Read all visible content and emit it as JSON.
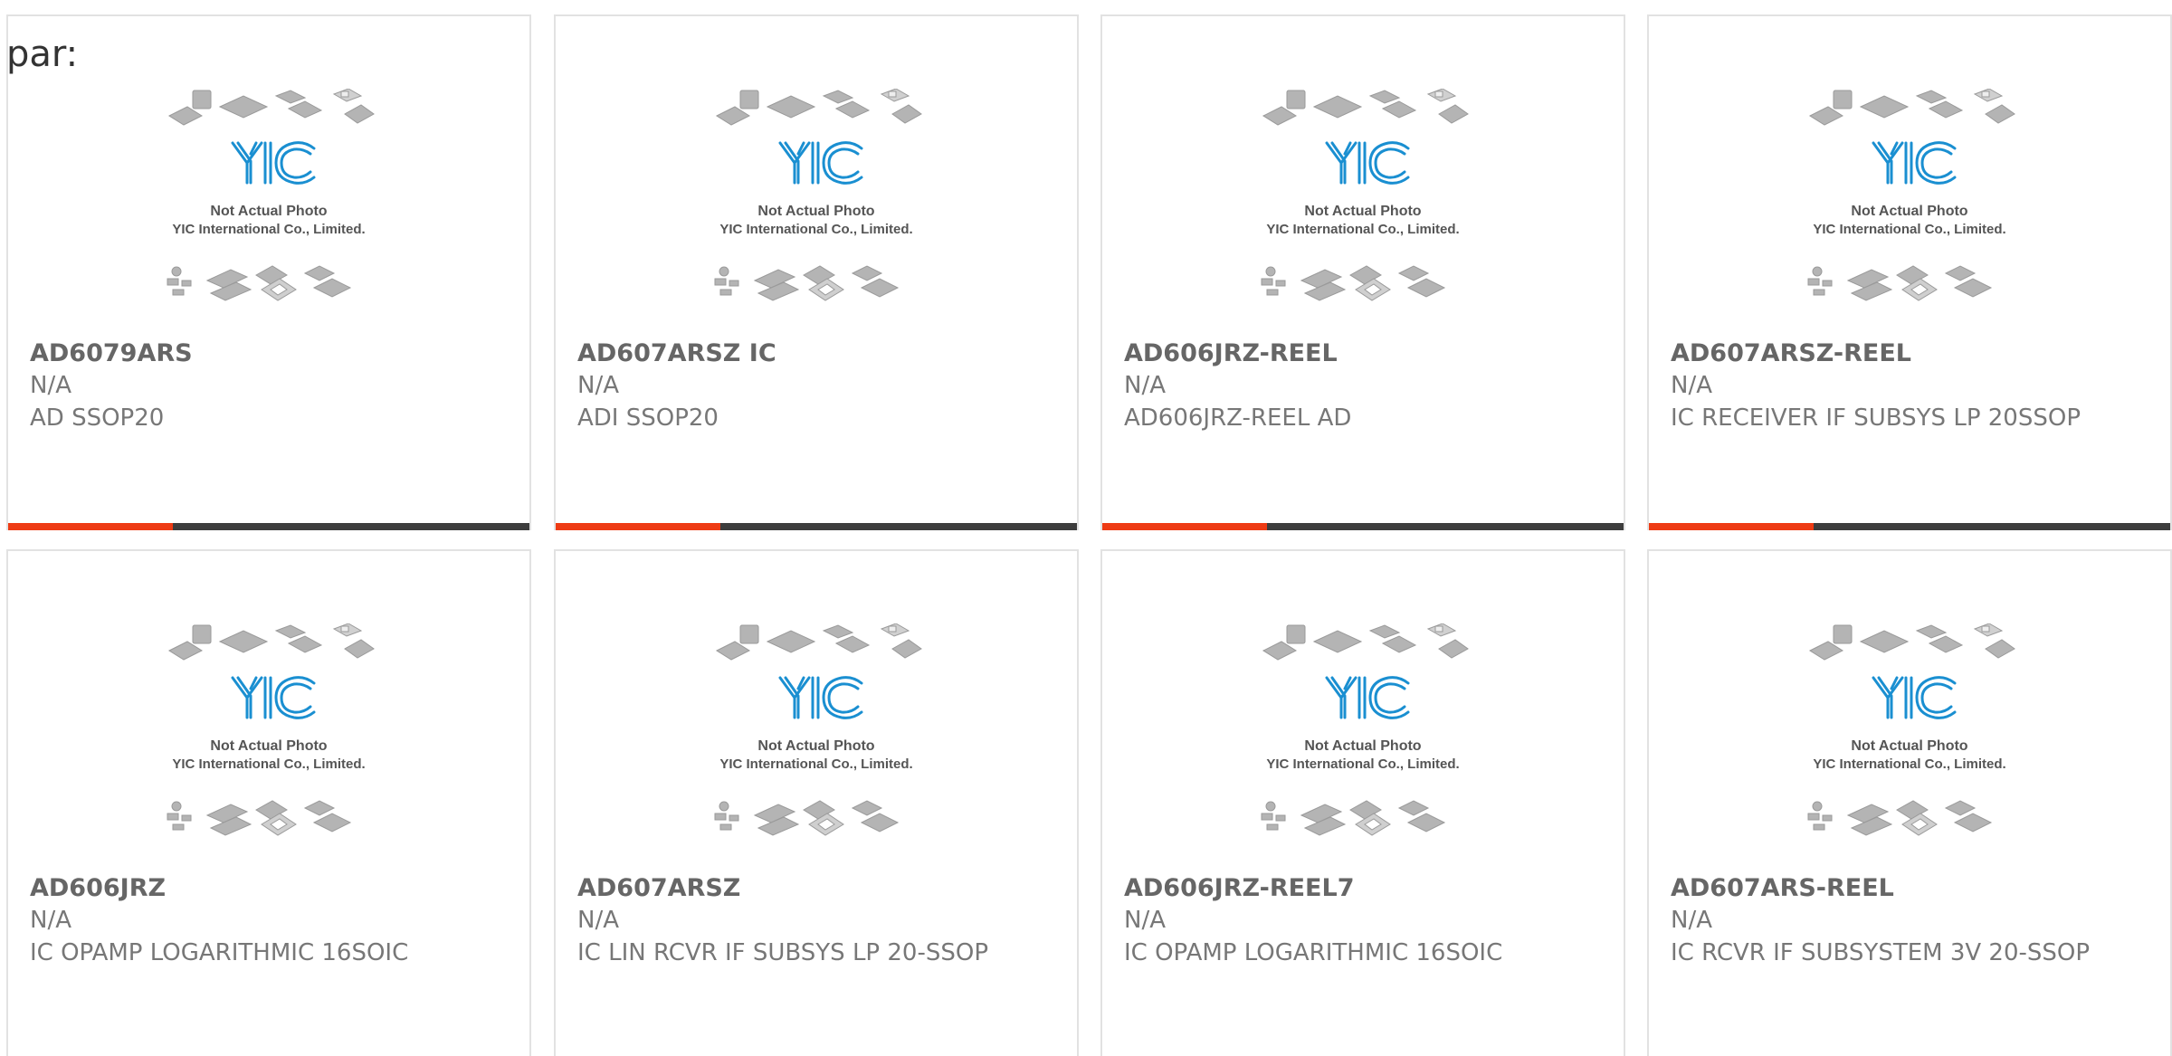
{
  "header": {
    "prefix": "par:"
  },
  "placeholder_image": {
    "line1": "Not Actual Photo",
    "line2": "YIC International Co., Limited.",
    "logo_text": "YIC"
  },
  "colors": {
    "accent": "#ee3b14",
    "bar": "#3d3d3d",
    "border": "#e2e2e2",
    "logo": "#1a8fd1"
  },
  "products": [
    {
      "name": "AD6079ARS",
      "manufacturer": "N/A",
      "description": "AD SSOP20"
    },
    {
      "name": "AD607ARSZ IC",
      "manufacturer": "N/A",
      "description": "ADI SSOP20"
    },
    {
      "name": "AD606JRZ-REEL",
      "manufacturer": "N/A",
      "description": "AD606JRZ-REEL AD"
    },
    {
      "name": "AD607ARSZ-REEL",
      "manufacturer": "N/A",
      "description": "IC RECEIVER IF SUBSYS LP 20SSOP"
    },
    {
      "name": "AD606JRZ",
      "manufacturer": "N/A",
      "description": "IC OPAMP LOGARITHMIC 16SOIC"
    },
    {
      "name": "AD607ARSZ",
      "manufacturer": "N/A",
      "description": "IC LIN RCVR IF SUBSYS LP 20-SSOP"
    },
    {
      "name": "AD606JRZ-REEL7",
      "manufacturer": "N/A",
      "description": "IC OPAMP LOGARITHMIC 16SOIC"
    },
    {
      "name": "AD607ARS-REEL",
      "manufacturer": "N/A",
      "description": "IC RCVR IF SUBSYSTEM 3V 20-SSOP"
    }
  ]
}
